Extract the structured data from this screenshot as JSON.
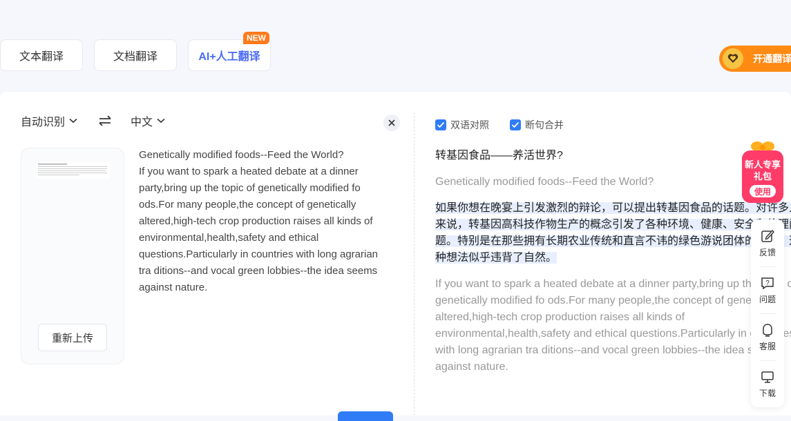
{
  "tabs": {
    "text_translate": "文本翻译",
    "doc_translate": "文档翻译",
    "ai_translate": "AI+人工翻译",
    "new_badge": "NEW"
  },
  "vip": {
    "label": "开通翻译"
  },
  "source_panel": {
    "source_lang": "自动识别",
    "target_lang": "中文",
    "reupload_label": "重新上传",
    "paragraphs": [
      "Genetically modified foods--Feed the World?",
      "If you want to spark a heated debate at a dinner party,bring up the topic of genetically modified fo ods.For many people,the concept of genetically altered,high-tech crop production raises all kinds of environmental,health,safety and ethical questions.Particularly in countries with long agrarian tra ditions--and vocal green lobbies--the idea seems against nature."
    ]
  },
  "result_panel": {
    "bilingual_label": "双语对照",
    "merge_label": "断句合并",
    "title_translation": "转基因食品——养活世界?",
    "title_original": "Genetically modified foods--Feed the World?",
    "para_translation": "如果你想在晚宴上引发激烈的辩论，可以提出转基因食品的话题。对许多人来说，转基因高科技作物生产的概念引发了各种环境、健康、安全和伦理问题。特别是在那些拥有长期农业传统和直言不讳的绿色游说团体的国家，这种想法似乎违背了自然。",
    "para_original": "If you want to spark a heated debate at a dinner party,bring up the topic of genetically modified fo ods.For many people,the concept of genetically altered,high-tech crop production raises all kinds of environmental,health,safety and ethical questions.Particularly in countries with long agrarian tra ditions--and vocal green lobbies--the idea seems against nature."
  },
  "gift": {
    "text": "新人专享礼包",
    "button": "使用"
  },
  "sidebar": {
    "feedback": "反馈",
    "question": "问题",
    "service": "客服",
    "download": "下载"
  }
}
